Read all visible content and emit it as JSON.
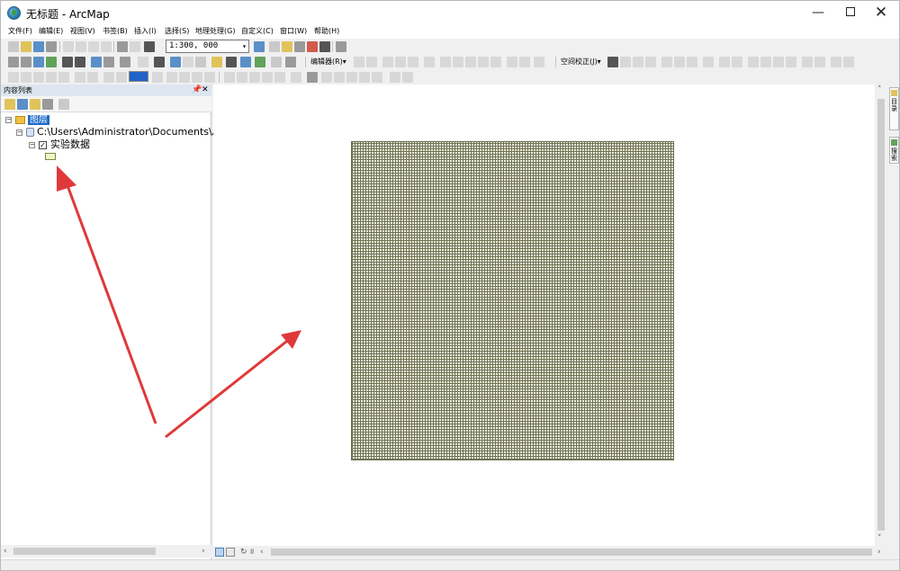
{
  "window": {
    "title": "无标题 - ArcMap",
    "minimize": "—",
    "close": "✕"
  },
  "menu": [
    "文件(F)",
    "编辑(E)",
    "视图(V)",
    "书签(B)",
    "插入(I)",
    "选择(S)",
    "地理处理(G)",
    "自定义(C)",
    "窗口(W)",
    "帮助(H)"
  ],
  "toolbar": {
    "scale_value": "1:300, 000",
    "editor_label": "编辑器(R)▾",
    "georef_label": "空间校正(J)▾"
  },
  "toc": {
    "title": "内容列表",
    "pin": "📌",
    "close": "✕",
    "layers_label": "图层",
    "path": "C:\\Users\\Administrator\\Documents\\ArcG",
    "layer_name": "实验数据",
    "expander_open": "−",
    "check_mark": "✓"
  },
  "right_dock": {
    "tab1": "目录",
    "tab2": "搜索"
  },
  "colors": {
    "grid_line": "#6f7252",
    "grid_fill": "#f4f6e8",
    "arrow": "#e0393a",
    "layers_highlight": "#1e6bc8"
  }
}
